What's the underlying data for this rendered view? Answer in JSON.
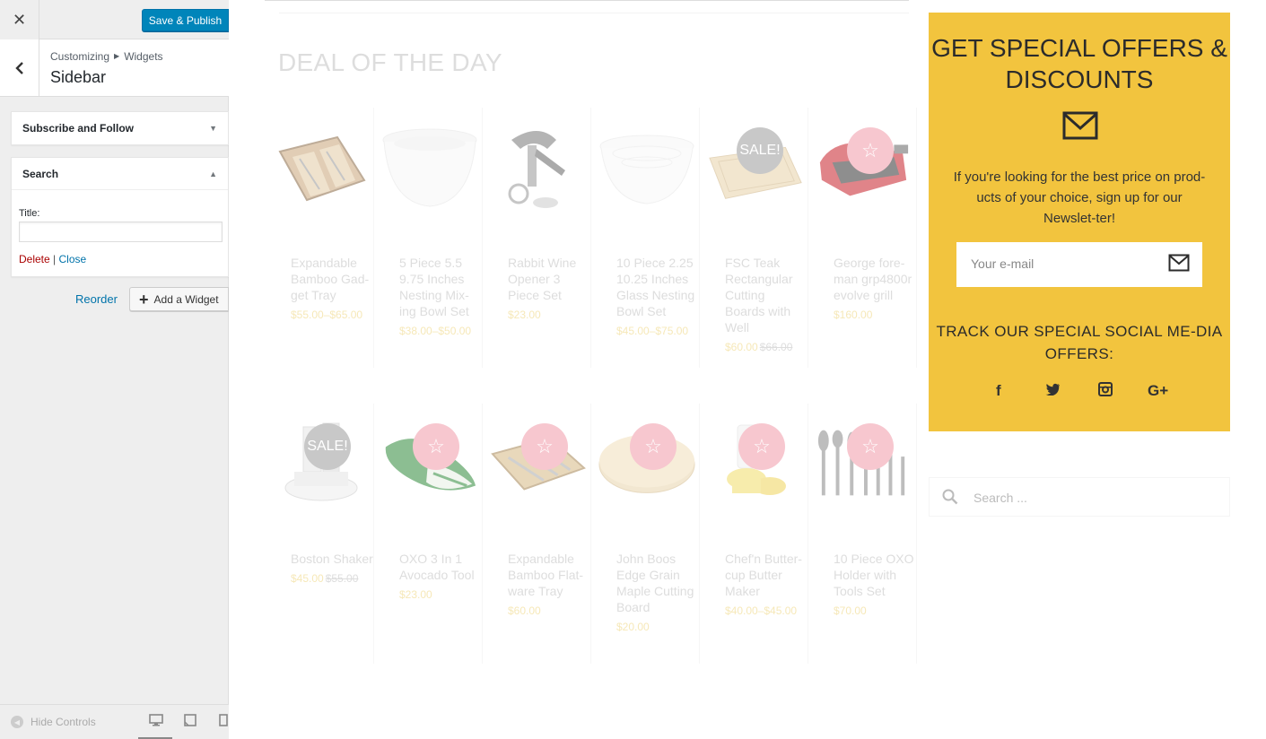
{
  "customizer": {
    "close_icon": "close-icon",
    "save_label": "Save & Publish",
    "breadcrumb_root": "Customizing",
    "breadcrumb_current": "Widgets",
    "section_title": "Sidebar",
    "widgets": [
      {
        "title": "Subscribe and Follow",
        "state": "collapsed"
      },
      {
        "title": "Search",
        "state": "expanded"
      }
    ],
    "search_widget": {
      "title_label": "Title:",
      "title_value": "",
      "delete_label": "Delete",
      "separator": "|",
      "close_label": "Close"
    },
    "reorder_label": "Reorder",
    "add_widget_label": "Add a Widget",
    "hide_controls_label": "Hide Controls",
    "devices": [
      "desktop",
      "tablet",
      "mobile"
    ],
    "active_device": "desktop",
    "colors": {
      "primary_button": "#0085ba",
      "delete": "#a00",
      "link": "#0073aa"
    }
  },
  "preview": {
    "deal_title": "DEAL OF THE DAY",
    "products": [
      {
        "name": "Expandable Bamboo Gad-get Tray",
        "price": "$55.00–$65.00",
        "old_price": "",
        "badge": "",
        "img": "tray"
      },
      {
        "name": "5 Piece 5.5 9.75 Inches Nesting Mix-ing Bowl Set",
        "price": "$38.00–$50.00",
        "old_price": "",
        "badge": "",
        "img": "bowl"
      },
      {
        "name": "Rabbit Wine Opener 3 Piece Set",
        "price": "$23.00",
        "old_price": "",
        "badge": "",
        "img": "opener"
      },
      {
        "name": "10 Piece 2.25 10.25 Inches Glass Nesting Bowl Set",
        "price": "$45.00–$75.00",
        "old_price": "",
        "badge": "",
        "img": "glassbowl"
      },
      {
        "name": "FSC Teak Rectangular Cutting Boards with Well",
        "price": "$60.00",
        "old_price": "$66.00",
        "badge": "SALE!",
        "img": "board"
      },
      {
        "name": "George fore-man grp4800r evolve grill",
        "price": "$160.00",
        "old_price": "",
        "badge": "star",
        "img": "grill"
      },
      {
        "name": "Boston Shaker",
        "price": "$45.00",
        "old_price": "$55.00",
        "badge": "SALE!",
        "img": "shaker"
      },
      {
        "name": "OXO 3 In 1 Avocado Tool",
        "price": "$23.00",
        "old_price": "",
        "badge": "star",
        "img": "avocado"
      },
      {
        "name": "Expandable Bamboo Flat-ware Tray",
        "price": "$60.00",
        "old_price": "",
        "badge": "star",
        "img": "flatware"
      },
      {
        "name": "John Boos Edge Grain Maple Cutting Board",
        "price": "$20.00",
        "old_price": "",
        "badge": "star",
        "img": "round"
      },
      {
        "name": "Chef'n Butter-cup Butter Maker",
        "price": "$40.00–$45.00",
        "old_price": "",
        "badge": "star",
        "img": "butter"
      },
      {
        "name": "10 Piece OXO Holder with Tools Set",
        "price": "$70.00",
        "old_price": "",
        "badge": "star",
        "img": "tools"
      }
    ],
    "newsletter": {
      "title": "GET SPECIAL OFFERS & DISCOUNTS",
      "text": "If you're looking for the best price on prod-ucts of your choice, sign up for our Newslet-ter!",
      "email_placeholder": "Your e-mail",
      "track_title": "TRACK OUR SPECIAL SOCIAL ME-DIA OFFERS:",
      "socials": [
        "facebook-icon",
        "twitter-icon",
        "instagram-icon",
        "google-plus-icon"
      ],
      "bg_color": "#f2c43e"
    },
    "search_placeholder": "Search ..."
  }
}
